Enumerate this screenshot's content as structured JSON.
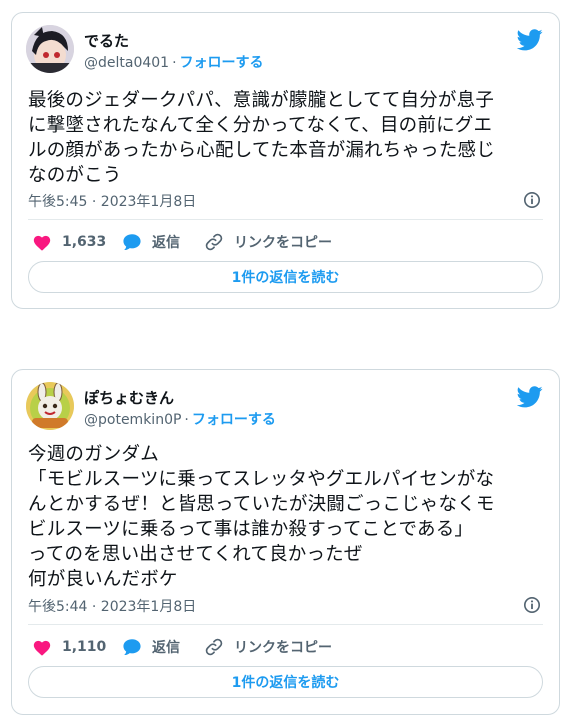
{
  "tweets": [
    {
      "name": "でるた",
      "handle": "@delta0401",
      "separator": "·",
      "follow_label": "フォローする",
      "text": "最後のジェダークパパ、意識が朦朧としてて自分が息子\nに撃墜されたなんて全く分かってなくて、目の前にグエ\nルの顔があったから心配してた本音が漏れちゃった感じ\nなのがこう",
      "timestamp": "午後5:45 · 2023年1月8日",
      "like_count": "1,633",
      "reply_label": "返信",
      "copy_link_label": "リンクをコピー",
      "replies_button_label": "1件の返信を読む"
    },
    {
      "name": "ぽちょむきん",
      "handle": "@potemkin0P",
      "separator": "·",
      "follow_label": "フォローする",
      "text": "今週のガンダム\n「モビルスーツに乗ってスレッタやグエルパイセンがな\nんとかするぜ！と皆思っていたが決闘ごっこじゃなくモ\nビルスーツに乗るって事は誰か殺すってことである」\nってのを思い出させてくれて良かったぜ\n何が良いんだボケ",
      "timestamp": "午後5:44 · 2023年1月8日",
      "like_count": "1,110",
      "reply_label": "返信",
      "copy_link_label": "リンクをコピー",
      "replies_button_label": "1件の返信を読む"
    }
  ],
  "icons": {
    "brand": "twitter-bird-icon",
    "info": "info-icon",
    "like": "heart-icon",
    "reply": "speech-bubble-icon",
    "copy_link": "link-icon"
  },
  "colors": {
    "accent": "#1d9bf0",
    "like": "#f91880",
    "text": "#0f1419",
    "muted": "#536471",
    "border": "#cfd9de"
  }
}
